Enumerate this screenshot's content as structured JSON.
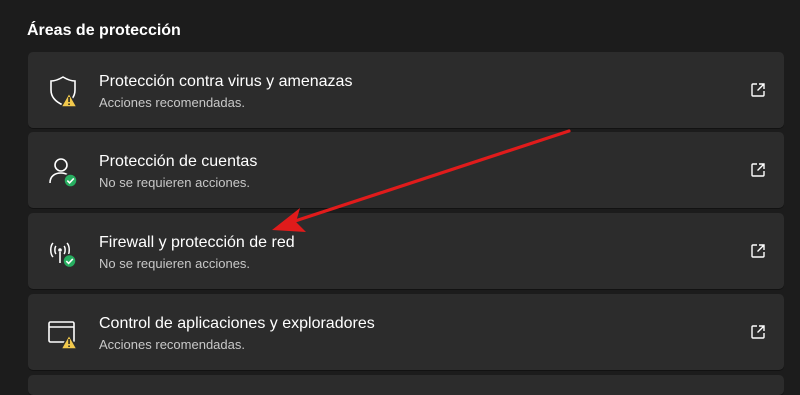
{
  "section": {
    "title": "Áreas de protección"
  },
  "cards": [
    {
      "title": "Protección contra virus y amenazas",
      "subtitle": "Acciones recomendadas.",
      "icon": "shield-icon",
      "status": "warning"
    },
    {
      "title": "Protección de cuentas",
      "subtitle": "No se requieren acciones.",
      "icon": "person-icon",
      "status": "ok"
    },
    {
      "title": "Firewall y protección de red",
      "subtitle": "No se requieren acciones.",
      "icon": "antenna-icon",
      "status": "ok"
    },
    {
      "title": "Control de aplicaciones y exploradores",
      "subtitle": "Acciones recomendadas.",
      "icon": "app-window-icon",
      "status": "warning"
    }
  ],
  "colors": {
    "background": "#1c1c1c",
    "card": "#2c2c2c",
    "warning": "#f2c94c",
    "ok": "#27ae60",
    "annotation_arrow": "#e01b1b"
  }
}
